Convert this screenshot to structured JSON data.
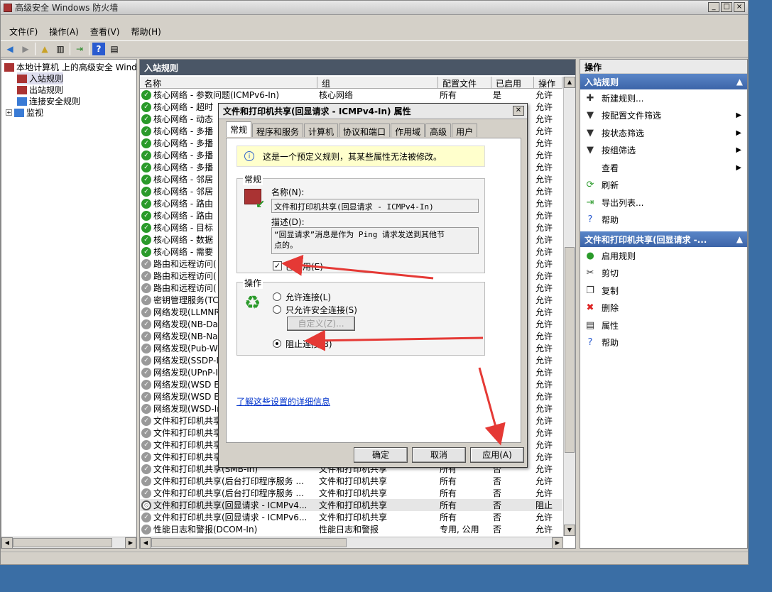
{
  "window": {
    "title": "高级安全 Windows 防火墙",
    "buttons": [
      "_",
      "□",
      "×"
    ]
  },
  "menu": [
    "文件(F)",
    "操作(A)",
    "查看(V)",
    "帮助(H)"
  ],
  "tree": {
    "root": "本地计算机 上的高级安全 Wind",
    "items": [
      "入站规则",
      "出站规则",
      "连接安全规则",
      "监视"
    ]
  },
  "center": {
    "title": "入站规则",
    "columns": [
      "名称",
      "组",
      "配置文件",
      "已启用",
      "操作"
    ],
    "rows": [
      {
        "icon": "green",
        "name": "核心网络 - 参数问题(ICMPv6-In)",
        "group": "核心网络",
        "profile": "所有",
        "enabled": "是",
        "action": "允许"
      },
      {
        "icon": "green",
        "name": "核心网络 - 超时",
        "group": "",
        "profile": "",
        "enabled": "",
        "action": "允许"
      },
      {
        "icon": "green",
        "name": "核心网络 - 动态",
        "group": "",
        "profile": "",
        "enabled": "",
        "action": "允许"
      },
      {
        "icon": "green",
        "name": "核心网络 - 多播",
        "group": "",
        "profile": "",
        "enabled": "",
        "action": "允许"
      },
      {
        "icon": "green",
        "name": "核心网络 - 多播",
        "group": "",
        "profile": "",
        "enabled": "",
        "action": "允许"
      },
      {
        "icon": "green",
        "name": "核心网络 - 多播",
        "group": "",
        "profile": "",
        "enabled": "",
        "action": "允许"
      },
      {
        "icon": "green",
        "name": "核心网络 - 多播",
        "group": "",
        "profile": "",
        "enabled": "",
        "action": "允许"
      },
      {
        "icon": "green",
        "name": "核心网络 - 邻居",
        "group": "",
        "profile": "",
        "enabled": "",
        "action": "允许"
      },
      {
        "icon": "green",
        "name": "核心网络 - 邻居",
        "group": "",
        "profile": "",
        "enabled": "",
        "action": "允许"
      },
      {
        "icon": "green",
        "name": "核心网络 - 路由",
        "group": "",
        "profile": "",
        "enabled": "",
        "action": "允许"
      },
      {
        "icon": "green",
        "name": "核心网络 - 路由",
        "group": "",
        "profile": "",
        "enabled": "",
        "action": "允许"
      },
      {
        "icon": "green",
        "name": "核心网络 - 目标",
        "group": "",
        "profile": "",
        "enabled": "",
        "action": "允许"
      },
      {
        "icon": "green",
        "name": "核心网络 - 数据",
        "group": "",
        "profile": "",
        "enabled": "",
        "action": "允许"
      },
      {
        "icon": "green",
        "name": "核心网络 - 需要",
        "group": "",
        "profile": "",
        "enabled": "",
        "action": "允许"
      },
      {
        "icon": "gray",
        "name": "路由和远程访问(",
        "group": "",
        "profile": "",
        "enabled": "",
        "action": "允许"
      },
      {
        "icon": "gray",
        "name": "路由和远程访问(",
        "group": "",
        "profile": "",
        "enabled": "",
        "action": "允许"
      },
      {
        "icon": "gray",
        "name": "路由和远程访问(",
        "group": "",
        "profile": "",
        "enabled": "",
        "action": "允许"
      },
      {
        "icon": "gray",
        "name": "密钥管理服务(TC",
        "group": "",
        "profile": "",
        "enabled": "",
        "action": "允许"
      },
      {
        "icon": "gray",
        "name": "网络发现(LLMNR-",
        "group": "",
        "profile": "",
        "enabled": "",
        "action": "允许"
      },
      {
        "icon": "gray",
        "name": "网络发现(NB-Dat",
        "group": "",
        "profile": "",
        "enabled": "",
        "action": "允许"
      },
      {
        "icon": "gray",
        "name": "网络发现(NB-Nam",
        "group": "",
        "profile": "",
        "enabled": "",
        "action": "允许"
      },
      {
        "icon": "gray",
        "name": "网络发现(Pub-WS",
        "group": "",
        "profile": "",
        "enabled": "",
        "action": "允许"
      },
      {
        "icon": "gray",
        "name": "网络发现(SSDP-I",
        "group": "",
        "profile": "",
        "enabled": "",
        "action": "允许"
      },
      {
        "icon": "gray",
        "name": "网络发现(UPnP-I",
        "group": "",
        "profile": "",
        "enabled": "",
        "action": "允许"
      },
      {
        "icon": "gray",
        "name": "网络发现(WSD Ev",
        "group": "",
        "profile": "",
        "enabled": "",
        "action": "允许"
      },
      {
        "icon": "gray",
        "name": "网络发现(WSD Ev",
        "group": "",
        "profile": "",
        "enabled": "",
        "action": "允许"
      },
      {
        "icon": "gray",
        "name": "网络发现(WSD-In",
        "group": "",
        "profile": "",
        "enabled": "",
        "action": "允许"
      },
      {
        "icon": "gray",
        "name": "文件和打印机共享",
        "group": "",
        "profile": "",
        "enabled": "",
        "action": "允许"
      },
      {
        "icon": "gray",
        "name": "文件和打印机共享",
        "group": "",
        "profile": "",
        "enabled": "",
        "action": "允许"
      },
      {
        "icon": "gray",
        "name": "文件和打印机共享",
        "group": "",
        "profile": "",
        "enabled": "",
        "action": "允许"
      },
      {
        "icon": "gray",
        "name": "文件和打印机共享",
        "group": "",
        "profile": "",
        "enabled": "",
        "action": "允许"
      },
      {
        "icon": "gray",
        "name": "文件和打印机共享(SMB-In)",
        "group": "文件和打印机共享",
        "profile": "所有",
        "enabled": "否",
        "action": "允许"
      },
      {
        "icon": "gray",
        "name": "文件和打印机共享(后台打印程序服务 ...",
        "group": "文件和打印机共享",
        "profile": "所有",
        "enabled": "否",
        "action": "允许"
      },
      {
        "icon": "gray",
        "name": "文件和打印机共享(后台打印程序服务 ...",
        "group": "文件和打印机共享",
        "profile": "所有",
        "enabled": "否",
        "action": "允许"
      },
      {
        "icon": "block",
        "name": "文件和打印机共享(回显请求 - ICMPv4...",
        "group": "文件和打印机共享",
        "profile": "所有",
        "enabled": "否",
        "action": "阻止",
        "selected": true
      },
      {
        "icon": "gray",
        "name": "文件和打印机共享(回显请求 - ICMPv6...",
        "group": "文件和打印机共享",
        "profile": "所有",
        "enabled": "否",
        "action": "允许"
      },
      {
        "icon": "gray",
        "name": "性能日志和警报(DCOM-In)",
        "group": "性能日志和警报",
        "profile": "专用, 公用",
        "enabled": "否",
        "action": "允许"
      }
    ]
  },
  "actions": {
    "title": "操作",
    "section1": "入站规则",
    "items1": [
      {
        "icon": "new-rule-icon",
        "glyph": "✚",
        "label": "新建规则...",
        "submenu": false
      },
      {
        "icon": "filter-icon",
        "glyph": "▼",
        "label": "按配置文件筛选",
        "submenu": true
      },
      {
        "icon": "filter-icon",
        "glyph": "▼",
        "label": "按状态筛选",
        "submenu": true
      },
      {
        "icon": "filter-icon",
        "glyph": "▼",
        "label": "按组筛选",
        "submenu": true
      },
      {
        "icon": "view-icon",
        "glyph": "",
        "label": "查看",
        "submenu": true
      },
      {
        "icon": "refresh-icon",
        "glyph": "⟳",
        "label": "刷新",
        "submenu": false
      },
      {
        "icon": "export-icon",
        "glyph": "⇥",
        "label": "导出列表...",
        "submenu": false
      },
      {
        "icon": "help-icon",
        "glyph": "?",
        "label": "帮助",
        "submenu": false
      }
    ],
    "section2": "文件和打印机共享(回显请求 -...",
    "items2": [
      {
        "icon": "enable-icon",
        "glyph": "●",
        "label": "启用规则"
      },
      {
        "icon": "cut-icon",
        "glyph": "✂",
        "label": "剪切"
      },
      {
        "icon": "copy-icon",
        "glyph": "❐",
        "label": "复制"
      },
      {
        "icon": "delete-icon",
        "glyph": "✖",
        "label": "删除"
      },
      {
        "icon": "properties-icon",
        "glyph": "▤",
        "label": "属性"
      },
      {
        "icon": "help-icon",
        "glyph": "?",
        "label": "帮助"
      }
    ]
  },
  "dialog": {
    "title": "文件和打印机共享(回显请求 - ICMPv4-In) 属性",
    "tabs": [
      "常规",
      "程序和服务",
      "计算机",
      "协议和端口",
      "作用域",
      "高级",
      "用户"
    ],
    "info": "这是一个预定义规则，其某些属性无法被修改。",
    "general_group": "常规",
    "name_label": "名称(N):",
    "name_value": "文件和打印机共享(回显请求 - ICMPv4-In)",
    "desc_label": "描述(D):",
    "desc_line1": "“回显请求”消息是作为 Ping 请求发送到其他节",
    "desc_line2": "点的。",
    "enabled_label": "已启用(E)",
    "enabled": true,
    "action_group": "操作",
    "opt_allow": "允许连接(L)",
    "opt_secure": "只允许安全连接(S)",
    "custom_btn": "自定义(Z)...",
    "opt_block": "阻止连接(B)",
    "selected_option": "block",
    "link": "了解这些设置的详细信息",
    "ok": "确定",
    "cancel": "取消",
    "apply": "应用(A)"
  }
}
